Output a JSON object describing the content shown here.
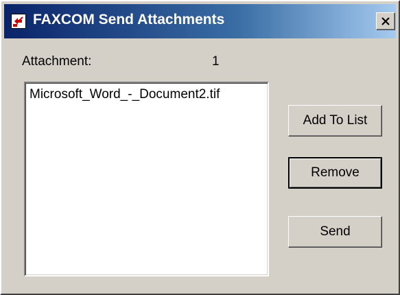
{
  "window": {
    "title": "FAXCOM Send Attachments",
    "icon": "faxcom-app-icon",
    "close_icon": "close-icon"
  },
  "attachment": {
    "label": "Attachment:",
    "count": "1"
  },
  "attachments_list": {
    "items": [
      "Microsoft_Word_-_Document2.tif"
    ]
  },
  "buttons": {
    "add_to_list": "Add To List",
    "remove": "Remove",
    "send": "Send"
  },
  "colors": {
    "title_bar_start": "#0a246a",
    "title_bar_end": "#a6caf0",
    "dialog_face": "#d4d0c8"
  }
}
